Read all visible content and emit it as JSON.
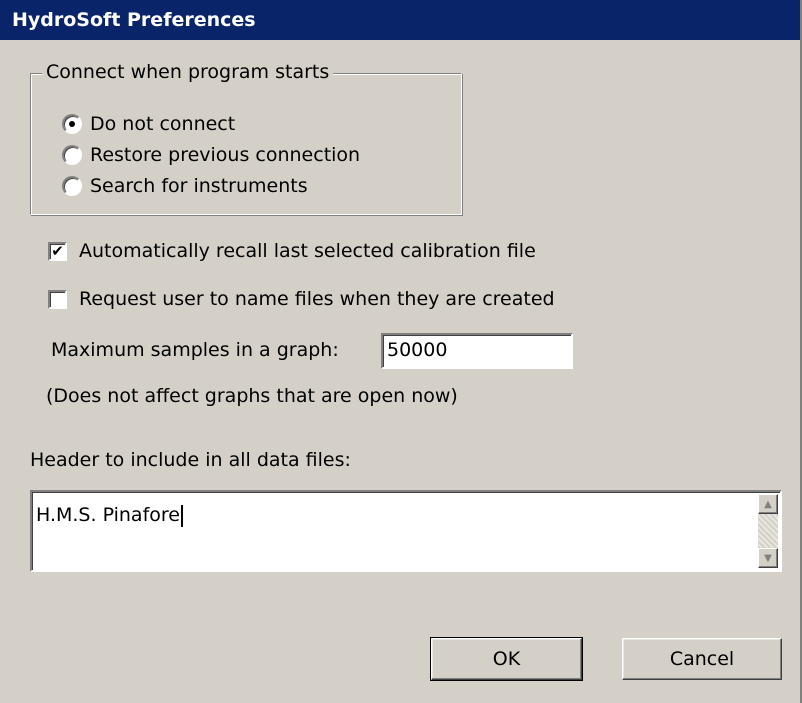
{
  "window": {
    "title": "HydroSoft Preferences"
  },
  "connect_group": {
    "legend": "Connect when program starts",
    "options": [
      {
        "label": "Do not connect",
        "checked": true
      },
      {
        "label": "Restore previous connection",
        "checked": false
      },
      {
        "label": "Search for instruments",
        "checked": false
      }
    ]
  },
  "options": {
    "auto_recall": {
      "label": "Automatically recall last selected calibration file",
      "checked": true
    },
    "request_name": {
      "label": "Request user to name files when they are created",
      "checked": false
    }
  },
  "max_samples": {
    "label": "Maximum samples in a graph:",
    "value": "50000",
    "note": "(Does not affect graphs that are open now)"
  },
  "header": {
    "label": "Header to include in all data files:",
    "value": "H.M.S. Pinafore"
  },
  "buttons": {
    "ok": "OK",
    "cancel": "Cancel"
  },
  "icons": {
    "check": "✔",
    "scroll_up": "▲",
    "scroll_down": "▼"
  }
}
